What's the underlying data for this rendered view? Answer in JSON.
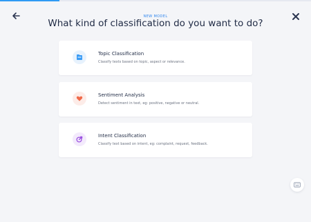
{
  "progress": 0.19,
  "header": {
    "eyebrow": "NEW MODEL",
    "title": "What kind of classification do you want to do?"
  },
  "icons": {
    "back": "arrow-left-icon",
    "close": "close-icon",
    "help": "keyboard-icon"
  },
  "options": [
    {
      "title": "Topic Classification",
      "description": "Classify texts based on topic, aspect or relevance.",
      "icon": "folder-icon",
      "icon_color": "#3b9cf5",
      "icon_bg": "#e7f2fd"
    },
    {
      "title": "Sentiment Analysis",
      "description": "Detect sentiment in text, eg: positive, negative or neutral.",
      "icon": "heart-icon",
      "icon_color": "#f06a4a",
      "icon_bg": "#fdece8"
    },
    {
      "title": "Intent Classification",
      "description": "Classify text based on intent, eg: complaint, request, feedback.",
      "icon": "target-arrow-icon",
      "icon_color": "#9b51e0",
      "icon_bg": "#f3eafc"
    }
  ]
}
